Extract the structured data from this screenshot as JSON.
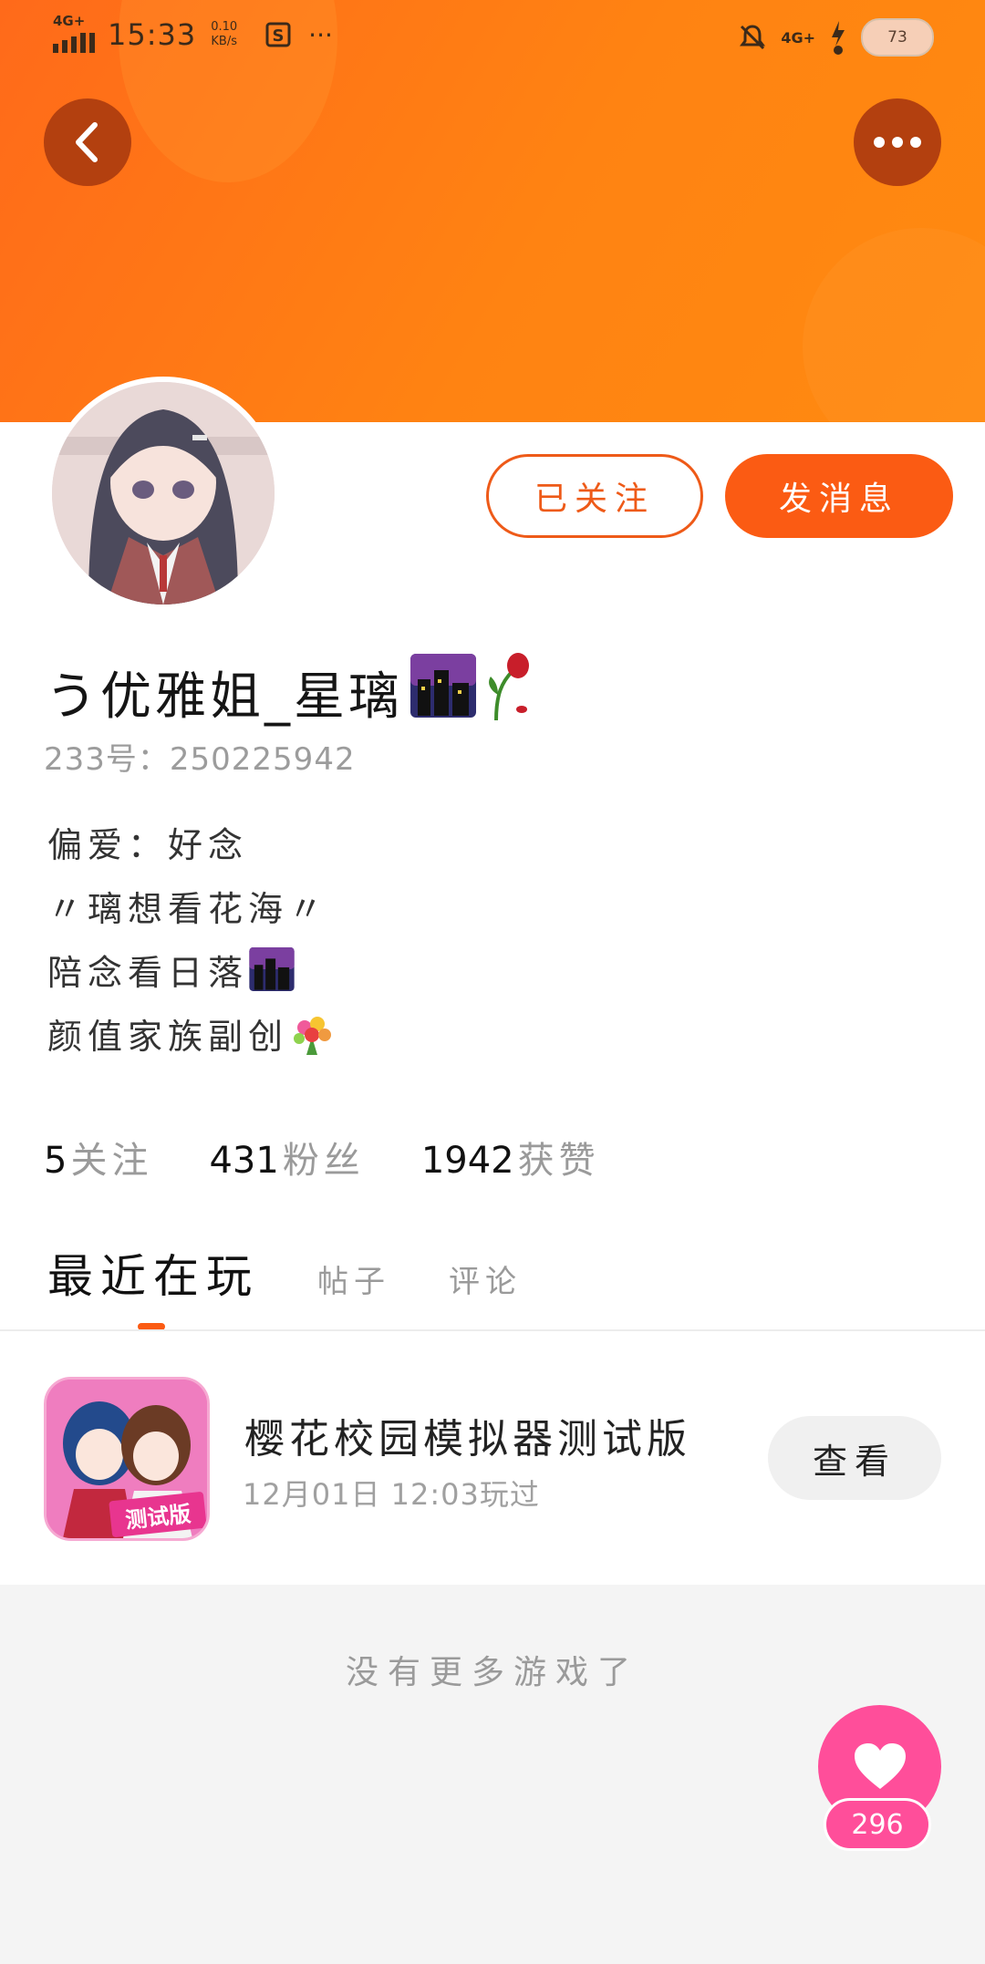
{
  "status_bar": {
    "network_left": "4G+",
    "time": "15:33",
    "speed_value": "0.10",
    "speed_unit": "KB/s",
    "more": "···",
    "network_right": "4G+",
    "battery": "73"
  },
  "profile": {
    "username": "う优雅姐_星璃",
    "user_id": "233号：250225942",
    "follow_button": "已关注",
    "message_button": "发消息",
    "bio": [
      "偏爱：好念",
      "〃璃想看花海〃",
      "陪念看日落",
      "颜值家族副创"
    ]
  },
  "stats": [
    {
      "count": "5",
      "label": "关注"
    },
    {
      "count": "431",
      "label": "粉丝"
    },
    {
      "count": "1942",
      "label": "获赞"
    }
  ],
  "tabs": {
    "active": "最近在玩",
    "posts": "帖子",
    "comments": "评论"
  },
  "recent_game": {
    "title": "樱花校园模拟器测试版",
    "played_time": "12月01日 12:03玩过",
    "view_button": "查看",
    "icon_badge": "测试版"
  },
  "list_end": "没有更多游戏了",
  "like": {
    "count": "296"
  },
  "colors": {
    "accent": "#fb5b13",
    "header": "#ff7a14",
    "like": "#ff4e9a"
  }
}
